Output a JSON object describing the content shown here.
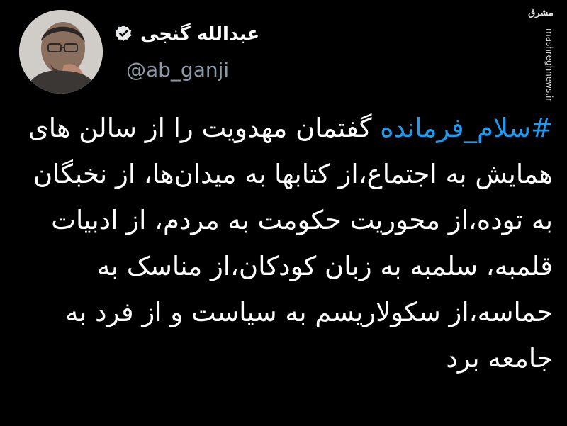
{
  "profile": {
    "display_name": "عبدالله گنجی",
    "handle": "@ab_ganji",
    "verified_icon": "verified-badge-icon",
    "avatar": "profile-photo"
  },
  "tweet": {
    "hashtag": "#سلام_فرمانده",
    "body": " گفتمان مهدویت را از سالن های همایش به اجتماع،از کتابها به میدان‌ها، از نخبگان به توده،از محوریت حکومت به مردم، از ادبیات قلمبه، سلمبه به زبان کودکان،از مناسک به حماسه،از سکولاریسم به سیاست و از فرد به جامعه برد"
  },
  "watermark": {
    "logo_text": "مشرق",
    "url": "mashreghnews.ir"
  },
  "colors": {
    "background": "#000000",
    "text": "#ffffff",
    "secondary_text": "#8b98a5",
    "link": "#1d9bf0",
    "verified_badge": "#e7e9ea"
  }
}
